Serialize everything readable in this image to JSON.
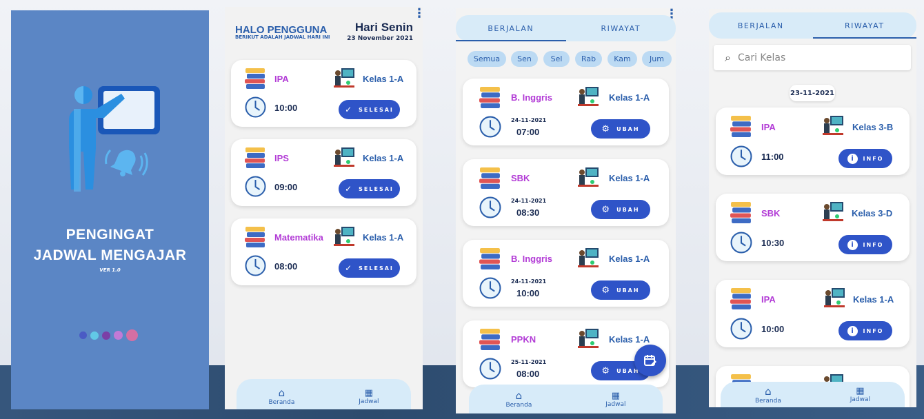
{
  "splash": {
    "title_line1": "PENGINGAT",
    "title_line2": "JADWAL MENGAJAR",
    "version": "VER 1.0",
    "dot_colors": [
      "#4a5bc4",
      "#62c8e6",
      "#7b3fa6",
      "#c27ad6",
      "#d46fa3"
    ]
  },
  "home": {
    "greeting": "HALO PENGGUNA",
    "subtitle": "BERIKUT ADALAH JADWAL HARI INI",
    "day": "Hari Senin",
    "date": "23 November 2021",
    "button_label": "SELESAI",
    "items": [
      {
        "subject": "IPA",
        "class": "Kelas 1-A",
        "time": "10:00"
      },
      {
        "subject": "IPS",
        "class": "Kelas 1-A",
        "time": "09:00"
      },
      {
        "subject": "Matematika",
        "class": "Kelas 1-A",
        "time": "08:00"
      }
    ]
  },
  "nav": {
    "home": "Beranda",
    "schedule": "Jadwal"
  },
  "schedule": {
    "tab_running": "BERJALAN",
    "tab_history": "RIWAYAT",
    "days": [
      "Semua",
      "Sen",
      "Sel",
      "Rab",
      "Kam",
      "Jum"
    ],
    "button_label": "UBAH",
    "items": [
      {
        "subject": "B. Inggris",
        "class": "Kelas 1-A",
        "date": "24-11-2021",
        "time": "07:00"
      },
      {
        "subject": "SBK",
        "class": "Kelas 1-A",
        "date": "24-11-2021",
        "time": "08:30"
      },
      {
        "subject": "B. Inggris",
        "class": "Kelas 1-A",
        "date": "24-11-2021",
        "time": "10:00"
      },
      {
        "subject": "PPKN",
        "class": "Kelas 1-A",
        "date": "25-11-2021",
        "time": "08:00"
      }
    ]
  },
  "history": {
    "search_placeholder": "Cari Kelas",
    "date_group": "23-11-2021",
    "button_label": "INFO",
    "items": [
      {
        "subject": "IPA",
        "class": "Kelas 3-B",
        "time": "11:00"
      },
      {
        "subject": "SBK",
        "class": "Kelas 3-D",
        "time": "10:30"
      },
      {
        "subject": "IPA",
        "class": "Kelas 1-A",
        "time": "10:00"
      }
    ]
  },
  "colors": {
    "primary": "#2f54c8",
    "subject": "#b23bd6",
    "splash_bg": "#5b86c5",
    "nav_bg": "#d7ebf9"
  }
}
